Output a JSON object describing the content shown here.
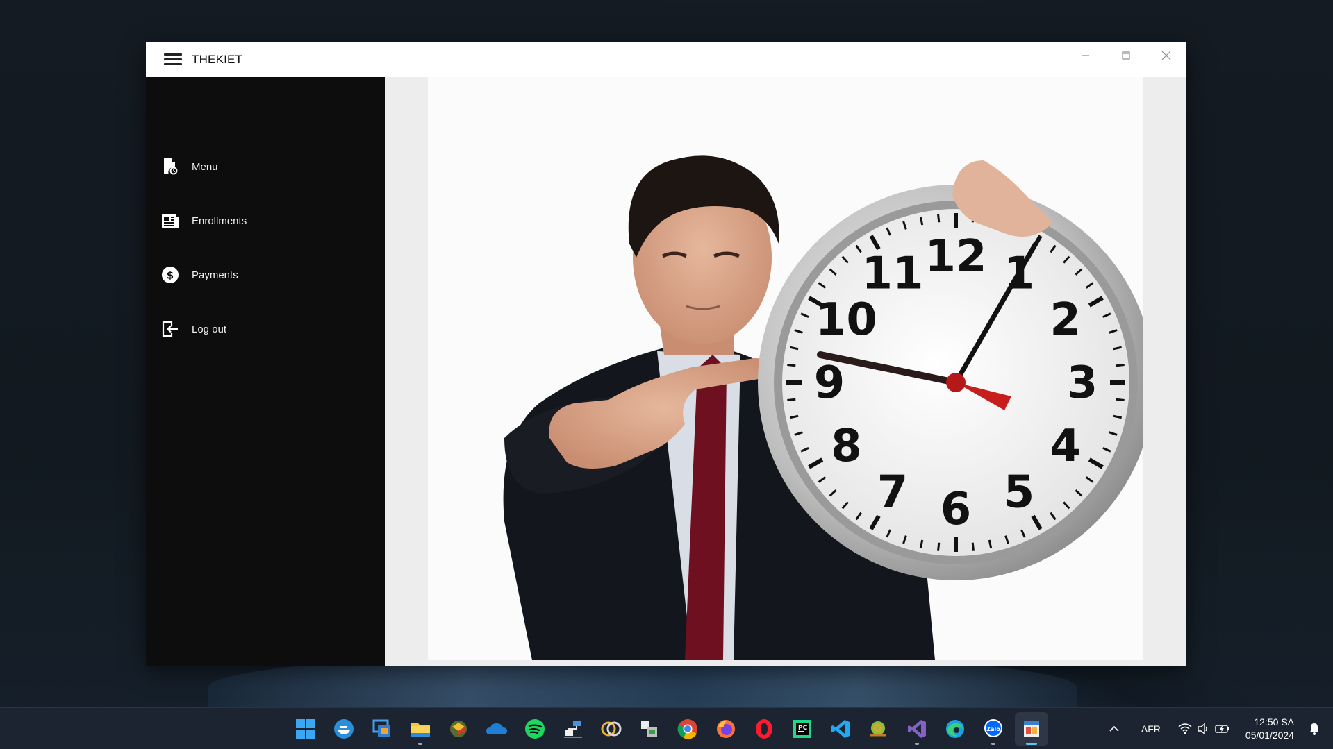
{
  "window": {
    "title": "THEKIET",
    "controls": [
      "minimize",
      "maximize",
      "close"
    ]
  },
  "sidebar": {
    "items": [
      {
        "label": "Menu",
        "icon": "menu-document-icon"
      },
      {
        "label": "Enrollments",
        "icon": "enrollments-list-icon"
      },
      {
        "label": "Payments",
        "icon": "dollar-circle-icon"
      },
      {
        "label": "Log out",
        "icon": "logout-icon"
      }
    ]
  },
  "content": {
    "image": "man-pointing-at-wall-clock",
    "clock_numbers": [
      "12",
      "1",
      "2",
      "3",
      "4",
      "5",
      "6",
      "7",
      "8",
      "9",
      "10",
      "11"
    ]
  },
  "taskbar": {
    "apps": [
      "windows-start-icon",
      "docker-icon",
      "remote-desktop-icon",
      "file-explorer-icon",
      "colored-app-icon",
      "onedrive-icon",
      "spotify-icon",
      "network-tool-icon",
      "rings-app-icon",
      "store-tool-icon",
      "chrome-icon",
      "firefox-icon",
      "opera-icon",
      "jetbrains-icon",
      "vscode-icon",
      "snail-app-icon",
      "visual-studio-icon",
      "edge-icon",
      "zalo-icon",
      "winforms-app-icon"
    ],
    "zalo_label": "Zalo",
    "tray": {
      "language": "AFR",
      "time": "12:50 SA",
      "date": "05/01/2024"
    }
  },
  "colors": {
    "sidebar_bg": "#0d0d0d",
    "titlebar_bg": "#ffffff",
    "content_bg": "#ededed",
    "taskbar_bg": "#1b2430"
  }
}
